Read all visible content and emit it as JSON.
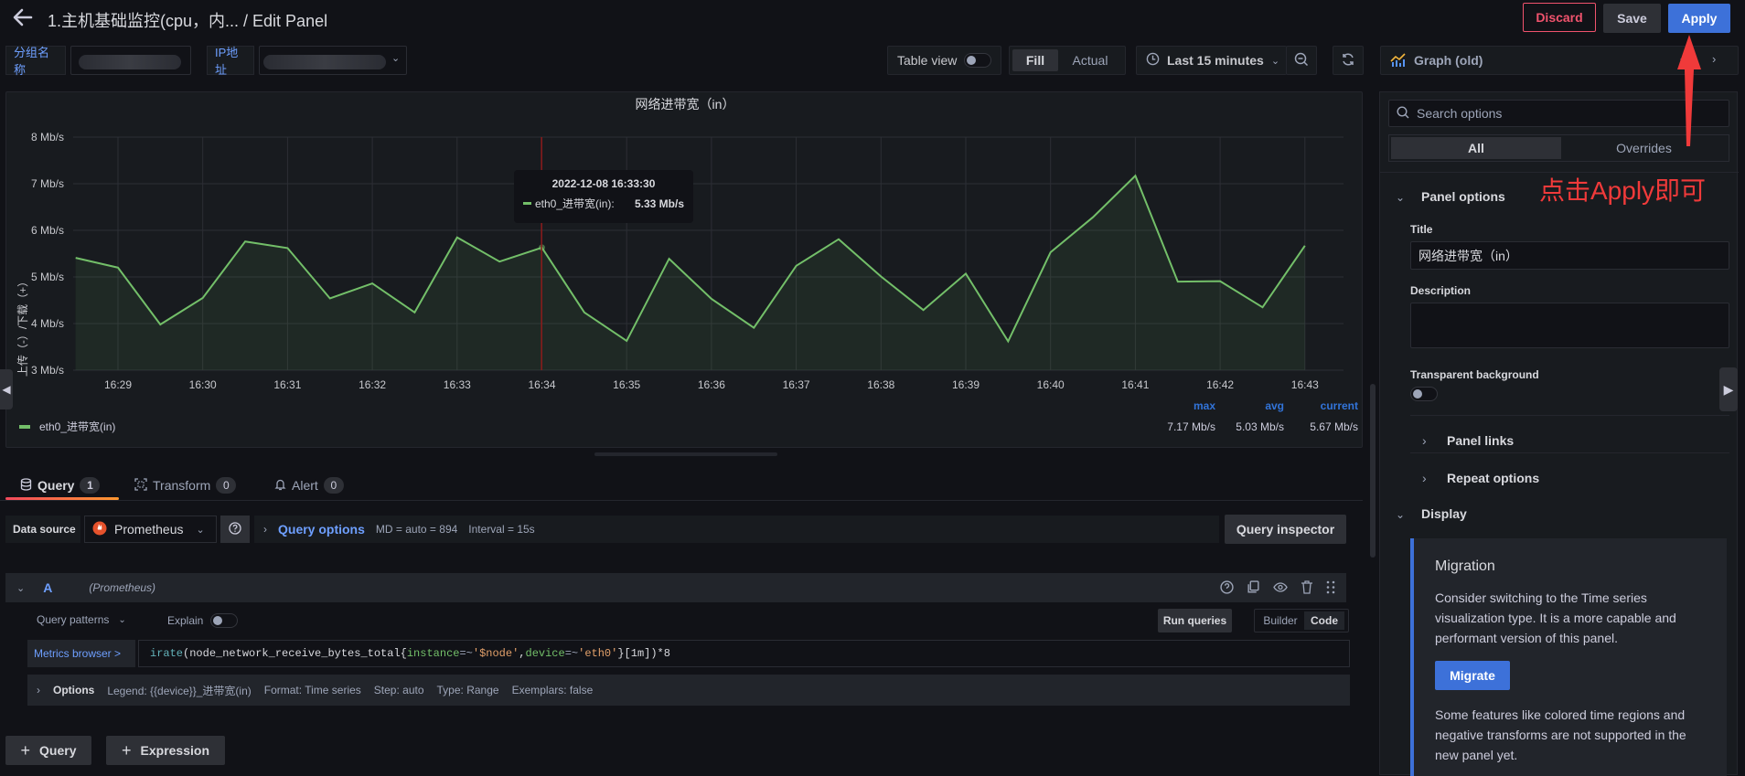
{
  "header": {
    "title": "1.主机基础监控(cpu，内...  / Edit Panel",
    "discard": "Discard",
    "save": "Save",
    "apply": "Apply"
  },
  "variables": [
    {
      "label": "分组名称",
      "value": ""
    },
    {
      "label": "IP地址",
      "value": ""
    }
  ],
  "toolbar": {
    "table_view": "Table view",
    "fill": "Fill",
    "actual": "Actual",
    "time_range": "Last 15 minutes",
    "viz_type": "Graph (old)"
  },
  "panel": {
    "title": "网络进带宽（in）",
    "tooltip": {
      "time": "2022-12-08 16:33:30",
      "series": "eth0_进带宽(in):",
      "value": "5.33 Mb/s"
    },
    "legend": {
      "series": "eth0_进带宽(in)",
      "headers": [
        "max",
        "avg",
        "current"
      ],
      "values": [
        "7.17 Mb/s",
        "5.03 Mb/s",
        "5.67 Mb/s"
      ]
    }
  },
  "chart_data": {
    "type": "area",
    "title": "网络进带宽（in）",
    "xlabel": "",
    "ylabel": "上传（-）/下载（+）",
    "ylim": [
      3,
      8
    ],
    "yticks": [
      "3 Mb/s",
      "4 Mb/s",
      "5 Mb/s",
      "6 Mb/s",
      "7 Mb/s",
      "8 Mb/s"
    ],
    "xticks": [
      "16:29",
      "16:30",
      "16:31",
      "16:32",
      "16:33",
      "16:34",
      "16:35",
      "16:36",
      "16:37",
      "16:38",
      "16:39",
      "16:40",
      "16:41",
      "16:42",
      "16:43"
    ],
    "grid": true,
    "legend": "bottom-left",
    "series": [
      {
        "name": "eth0_进带宽(in)",
        "color": "#73bf69",
        "x": [
          "16:28:30",
          "16:29",
          "16:29:30",
          "16:30",
          "16:30:30",
          "16:31",
          "16:31:30",
          "16:32",
          "16:32:30",
          "16:33",
          "16:33:30",
          "16:34",
          "16:34:30",
          "16:35",
          "16:35:30",
          "16:36",
          "16:36:30",
          "16:37",
          "16:37:30",
          "16:38",
          "16:38:30",
          "16:39",
          "16:39:30",
          "16:40",
          "16:40:30",
          "16:41",
          "16:41:30",
          "16:42",
          "16:42:30",
          "16:43"
        ],
        "values": [
          5.41,
          5.2,
          3.98,
          4.55,
          5.76,
          5.62,
          4.54,
          4.86,
          4.24,
          5.85,
          5.33,
          5.63,
          4.24,
          3.63,
          5.39,
          4.53,
          3.91,
          5.24,
          5.81,
          5.01,
          4.29,
          5.07,
          3.62,
          5.53,
          6.28,
          7.17,
          4.9,
          4.91,
          4.35,
          5.67
        ]
      }
    ],
    "hover_time": "16:33:30"
  },
  "query_tabs": [
    {
      "label": "Query",
      "count": "1"
    },
    {
      "label": "Transform",
      "count": "0"
    },
    {
      "label": "Alert",
      "count": "0"
    }
  ],
  "query": {
    "datasource_label": "Data source",
    "datasource": "Prometheus",
    "query_options": "Query options",
    "md": "MD = auto = 894",
    "interval": "Interval = 15s",
    "inspector": "Query inspector",
    "ref": "A",
    "ref_ds": "(Prometheus)",
    "patterns": "Query patterns",
    "explain": "Explain",
    "run": "Run queries",
    "builder": "Builder",
    "code": "Code",
    "metrics_browser": "Metrics browser >",
    "expr": {
      "fn": "irate",
      "metric": "node_network_receive_bytes_total",
      "l1": "instance",
      "v1": "'$node'",
      "l2": "device",
      "v2": "'eth0'",
      "range": "[1m]",
      "tail": ")*8"
    },
    "options_label": "Options",
    "options": [
      "Legend: {{device}}_进带宽(in)",
      "Format: Time series",
      "Step: auto",
      "Type: Range",
      "Exemplars: false"
    ],
    "add_query": "Query",
    "add_expression": "Expression"
  },
  "options_pane": {
    "search_placeholder": "Search options",
    "tab_all": "All",
    "tab_overrides": "Overrides",
    "panel_options": "Panel options",
    "title_label": "Title",
    "title_value": "网络进带宽（in）",
    "description_label": "Description",
    "transparent_label": "Transparent background",
    "panel_links": "Panel links",
    "repeat_options": "Repeat options",
    "display": "Display",
    "migration_title": "Migration",
    "migration_text": "Consider switching to the Time series visualization type. It is a more capable and performant version of this panel.",
    "migrate": "Migrate",
    "migration_note": "Some features like colored time regions and negative transforms are not supported in the new panel yet."
  },
  "annotation": {
    "text": "点击Apply即可",
    "color": "#f03a3a"
  }
}
